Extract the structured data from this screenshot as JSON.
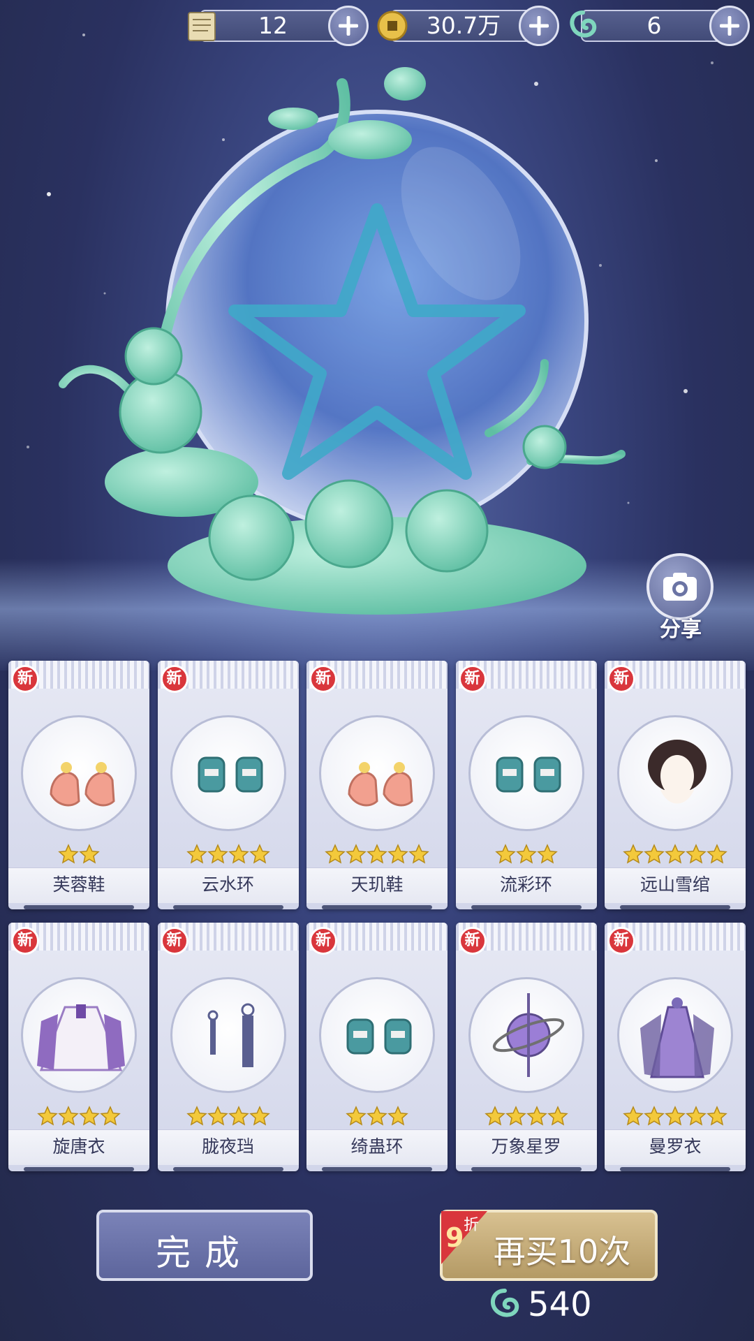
{
  "currencies": [
    {
      "name": "scroll-icon",
      "value": "12"
    },
    {
      "name": "coin-icon",
      "value": "30.7万"
    },
    {
      "name": "jade-dragon-icon",
      "value": "6"
    }
  ],
  "share": {
    "label": "分享"
  },
  "badge_new": "新",
  "items": [
    {
      "name": "芙蓉鞋",
      "stars": 2,
      "icon": "shoes-icon"
    },
    {
      "name": "云水环",
      "stars": 4,
      "icon": "bracelet-icon"
    },
    {
      "name": "天玑鞋",
      "stars": 5,
      "icon": "shoes-icon"
    },
    {
      "name": "流彩环",
      "stars": 3,
      "icon": "bracelet-icon"
    },
    {
      "name": "远山雪绾",
      "stars": 5,
      "icon": "hairstyle-icon"
    },
    {
      "name": "旋唐衣",
      "stars": 4,
      "icon": "robe-icon"
    },
    {
      "name": "胧夜珰",
      "stars": 4,
      "icon": "earring-icon"
    },
    {
      "name": "绮蛊环",
      "stars": 3,
      "icon": "bracelet-icon"
    },
    {
      "name": "万象星罗",
      "stars": 4,
      "icon": "armillary-ornament-icon"
    },
    {
      "name": "曼罗衣",
      "stars": 5,
      "icon": "dress-icon"
    }
  ],
  "buttons": {
    "done": "完成",
    "buy_again": "再买10次",
    "discount_num": "9",
    "discount_unit": "折",
    "cost": "540"
  },
  "colors": {
    "new_badge": "#d9363c",
    "star": "#f3c93b",
    "jade": "#7fd6bd"
  }
}
